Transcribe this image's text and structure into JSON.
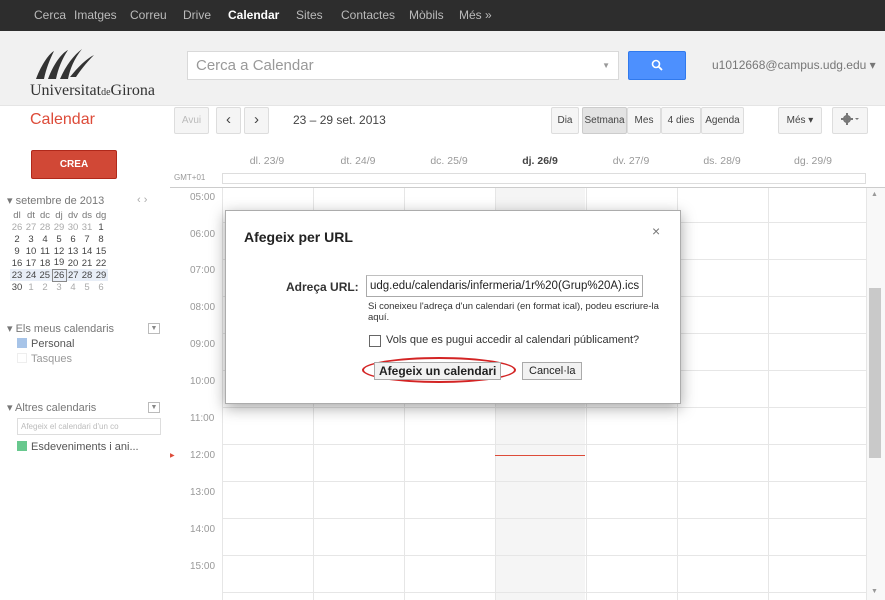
{
  "topnav": [
    "Cerca",
    "Imatges",
    "Correu",
    "Drive",
    "Calendar",
    "Sites",
    "Contactes",
    "Mòbils",
    "Més »"
  ],
  "topnav_active": "Calendar",
  "logo": {
    "main": "Universitat",
    "de": "de",
    "end": "Girona"
  },
  "search": {
    "placeholder": "Cerca a Calendar",
    "button_icon": "search-icon"
  },
  "account": "u1012668@campus.udg.edu ▾",
  "app_title": "Calendar",
  "toolbar": {
    "today": "Avui",
    "prev": "‹",
    "next": "›",
    "range": "23 – 29 set. 2013",
    "views": [
      "Dia",
      "Setmana",
      "Mes",
      "4 dies",
      "Agenda"
    ],
    "selected_view": "Setmana",
    "more": "Més ▾",
    "settings_icon": "gear-icon"
  },
  "sidebar": {
    "create": "CREA",
    "mini_month": "setembre de 2013",
    "mini_nav": "‹  ›",
    "weekdays": [
      "dl",
      "dt",
      "dc",
      "dj",
      "dv",
      "ds",
      "dg"
    ],
    "weeks": [
      [
        "26",
        "27",
        "28",
        "29",
        "30",
        "31",
        "1"
      ],
      [
        "2",
        "3",
        "4",
        "5",
        "6",
        "7",
        "8"
      ],
      [
        "9",
        "10",
        "11",
        "12",
        "13",
        "14",
        "15"
      ],
      [
        "16",
        "17",
        "18",
        "19",
        "20",
        "21",
        "22"
      ],
      [
        "23",
        "24",
        "25",
        "26",
        "27",
        "28",
        "29"
      ],
      [
        "30",
        "1",
        "2",
        "3",
        "4",
        "5",
        "6"
      ]
    ],
    "my_calendars": "Els meus calendaris",
    "my_items": [
      {
        "label": "Personal",
        "color": "#a7c4e8"
      },
      {
        "label": "Tasques",
        "color": "#ffffff"
      }
    ],
    "other_calendars": "Altres calendaris",
    "add_placeholder": "Afegeix el calendari d'un co",
    "other_items": [
      {
        "label": "Esdeveniments i ani...",
        "color": "#68c88e"
      }
    ]
  },
  "grid": {
    "timezone": "GMT+01",
    "days": [
      "dl. 23/9",
      "dt. 24/9",
      "dc. 25/9",
      "dj. 26/9",
      "dv. 27/9",
      "ds. 28/9",
      "dg. 29/9"
    ],
    "today_index": 3,
    "hours": [
      "05:00",
      "06:00",
      "07:00",
      "08:00",
      "09:00",
      "10:00",
      "11:00",
      "12:00",
      "13:00",
      "14:00",
      "15:00"
    ]
  },
  "dialog": {
    "title": "Afegeix per URL",
    "close": "×",
    "url_label": "Adreça URL:",
    "url_value": "udg.edu/calendaris/infermeria/1r%20(Grup%20A).ics",
    "hint": "Si coneixeu l'adreça d'un calendari (en format ical), podeu escriure-la aquí.",
    "checkbox_label": "Vols que es pugui accedir al calendari públicament?",
    "add_button": "Afegeix un calendari",
    "cancel_button": "Cancel·la"
  }
}
